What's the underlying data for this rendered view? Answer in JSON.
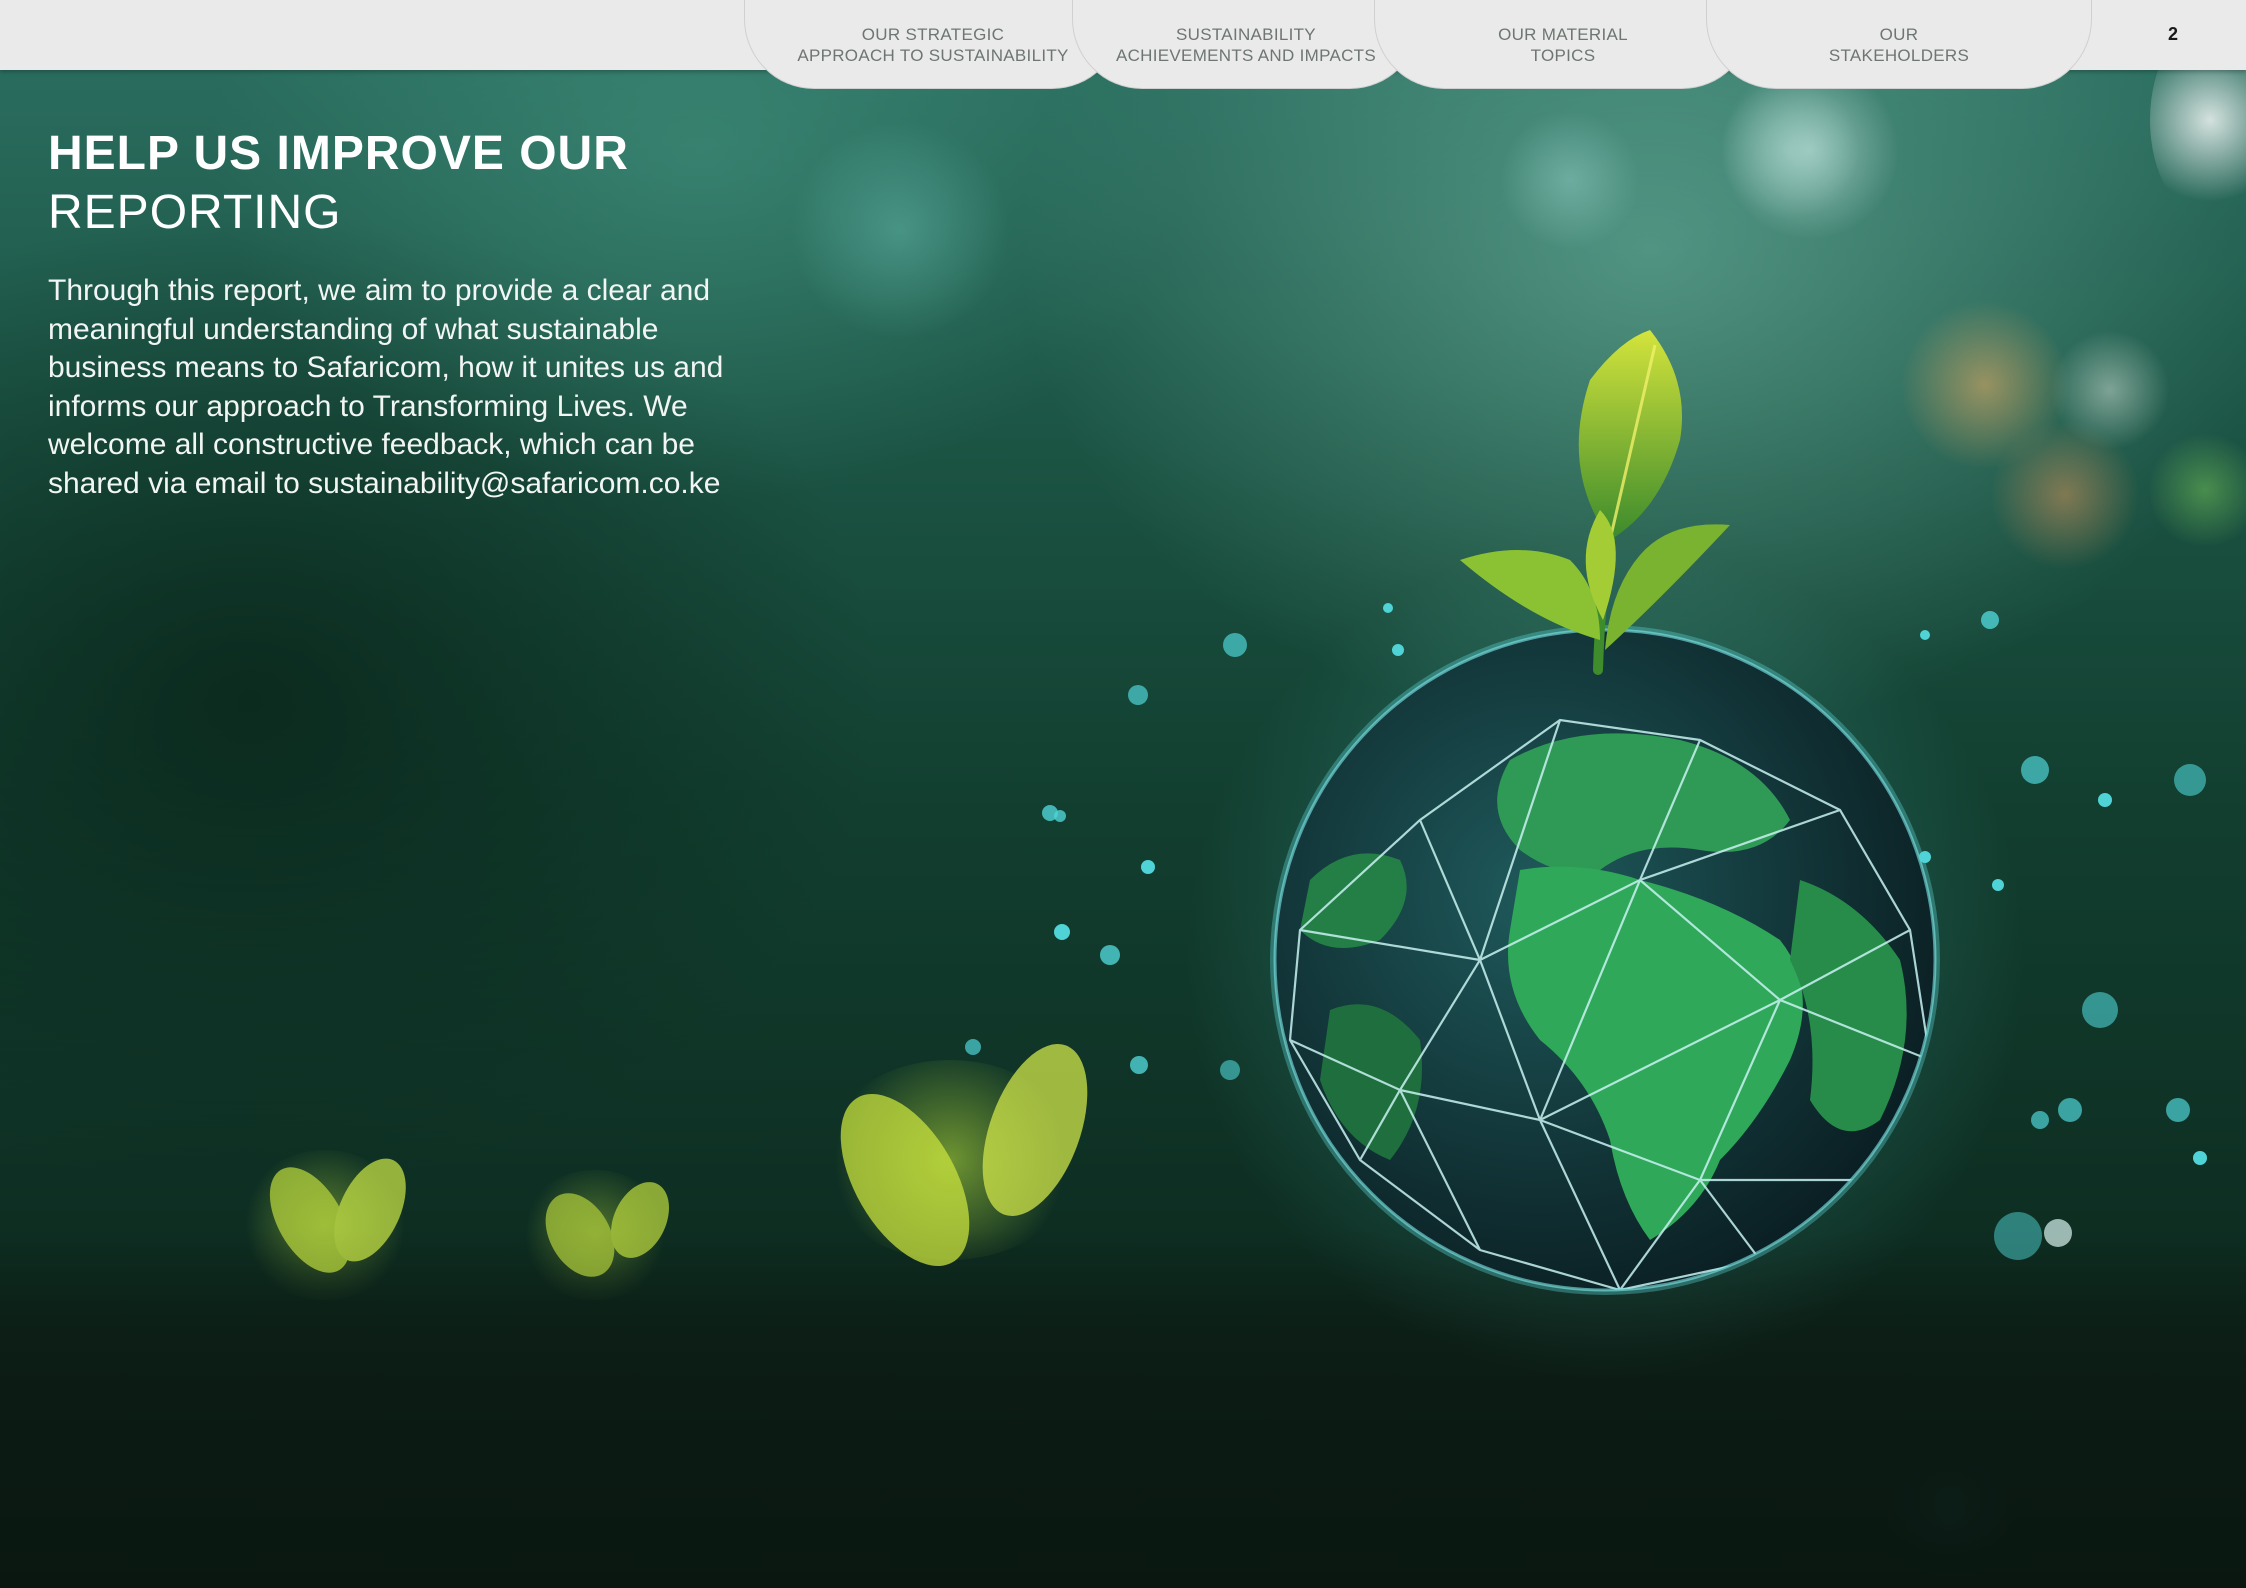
{
  "navigation": {
    "tabs": [
      {
        "label": "OUR STRATEGIC\nAPPROACH TO SUSTAINABILITY"
      },
      {
        "label": "SUSTAINABILITY\nACHIEVEMENTS AND IMPACTS"
      },
      {
        "label": "OUR MATERIAL\nTOPICS"
      },
      {
        "label": "OUR\nSTAKEHOLDERS"
      }
    ]
  },
  "page_number": "2",
  "heading": {
    "bold": "HELP US IMPROVE OUR",
    "light": "REPORTING"
  },
  "body": {
    "lines": [
      "Through this report, we aim to provide a clear and",
      "meaningful understanding of what sustainable",
      "business means to Safaricom, how it unites us and",
      "informs our approach to Transforming Lives. We",
      "welcome all constructive feedback, which can be",
      "shared via email to sustainability@safaricom.co.ke"
    ]
  },
  "hero_image": {
    "icon": "globe-with-sprout-icon",
    "colors": {
      "leaf": "#b8d62e",
      "globe_land": "#2f9a55",
      "globe_sea": "#0e2a2a",
      "sparkle": "#4fd3d6"
    }
  },
  "theme": {
    "topbar": "#e9eae9",
    "tab_text": "#6e7672",
    "heading_text": "#ffffff"
  }
}
